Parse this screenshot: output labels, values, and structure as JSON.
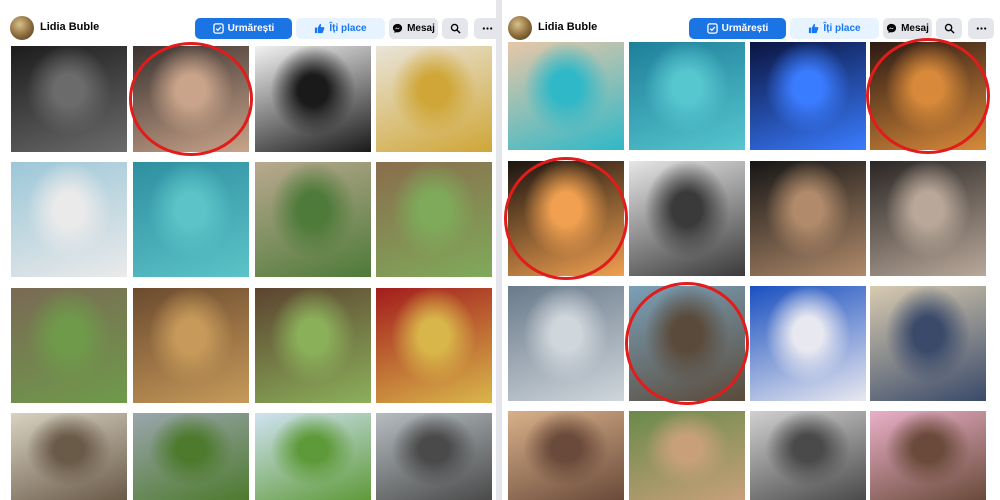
{
  "left": {
    "profile_name": "Lidia Buble",
    "buttons": {
      "follow_label": "Urmărești",
      "like_label": "Îți place",
      "message_label": "Mesaj"
    },
    "icons": {
      "follow": "follow-check-icon",
      "like": "thumbs-up-icon",
      "message": "messenger-icon",
      "search": "search-icon",
      "more": "more-dots-icon"
    },
    "photos": [
      {
        "desc": "black-and-white leather jacket portrait",
        "colors": [
          "#1c1c1c",
          "#6b6b6b"
        ]
      },
      {
        "desc": "couple kissing, woman in black hat",
        "colors": [
          "#3a3230",
          "#c9a48a"
        ],
        "circled": true
      },
      {
        "desc": "black blazer white background",
        "colors": [
          "#f2f2f2",
          "#1a1a1a"
        ]
      },
      {
        "desc": "yellow suit on white sofa",
        "colors": [
          "#e9e4d8",
          "#cfa637"
        ]
      },
      {
        "desc": "white dress by pool",
        "colors": [
          "#9cc7d8",
          "#eaeaea"
        ]
      },
      {
        "desc": "scuba diving underwater",
        "colors": [
          "#2f8fa0",
          "#5cc3c8"
        ]
      },
      {
        "desc": "monastery gate",
        "colors": [
          "#b9a98e",
          "#4e7a3a"
        ]
      },
      {
        "desc": "monastery well",
        "colors": [
          "#8a6d4d",
          "#7faa5a"
        ]
      },
      {
        "desc": "medieval wall courtyard",
        "colors": [
          "#7a6a55",
          "#6f9a4a"
        ]
      },
      {
        "desc": "painted church interior",
        "colors": [
          "#6b4a2e",
          "#c79a5a"
        ]
      },
      {
        "desc": "wooden house porch",
        "colors": [
          "#5c4330",
          "#8bb05a"
        ]
      },
      {
        "desc": "church altar with roses",
        "colors": [
          "#a31c1c",
          "#d9b64a"
        ]
      },
      {
        "desc": "white monastery gate",
        "colors": [
          "#d8d2c2",
          "#6a5a48"
        ]
      },
      {
        "desc": "grass hill cloudy sky",
        "colors": [
          "#9aa6ad",
          "#4e7a2e"
        ]
      },
      {
        "desc": "black hat on meadow",
        "colors": [
          "#cfe3f0",
          "#5f9a3a"
        ]
      },
      {
        "desc": "church dome cloudy",
        "colors": [
          "#b5bcc0",
          "#4a4a4a"
        ]
      }
    ]
  },
  "right": {
    "profile_name": "Lidia Buble",
    "buttons": {
      "follow_label": "Urmărești",
      "like_label": "Îți place",
      "message_label": "Mesaj"
    },
    "icons": {
      "follow": "follow-check-icon",
      "like": "thumbs-up-icon",
      "message": "messenger-icon",
      "search": "search-icon",
      "more": "more-dots-icon"
    },
    "photos": [
      {
        "desc": "sunbathing on pool float",
        "colors": [
          "#e8c7a8",
          "#2fb8c7"
        ]
      },
      {
        "desc": "diving underwater",
        "colors": [
          "#1e7f9a",
          "#56c6cf"
        ]
      },
      {
        "desc": "blue neon portrait",
        "colors": [
          "#0a1440",
          "#3a7cff"
        ]
      },
      {
        "desc": "sunset couple kiss",
        "colors": [
          "#2b1a14",
          "#d88a3a"
        ],
        "circled": true
      },
      {
        "desc": "sunset beach silhouette",
        "colors": [
          "#1a1410",
          "#f0a050"
        ],
        "circled": true
      },
      {
        "desc": "palm trees black and white",
        "colors": [
          "#e6e6e6",
          "#3a3a3a"
        ]
      },
      {
        "desc": "sunglasses dark portrait",
        "colors": [
          "#151515",
          "#b08a6a"
        ]
      },
      {
        "desc": "chanel outfit on sofa",
        "colors": [
          "#2a2624",
          "#b9a89a"
        ]
      },
      {
        "desc": "sitting on stone ledge airport",
        "colors": [
          "#6a7a8a",
          "#cfd6dc"
        ]
      },
      {
        "desc": "selfie couple outdoors",
        "colors": [
          "#7aa0b8",
          "#5a4a3a"
        ],
        "circled": true
      },
      {
        "desc": "tv studio next star",
        "colors": [
          "#1a50c0",
          "#e8e8f0"
        ]
      },
      {
        "desc": "reading newspaper",
        "colors": [
          "#d8cbb0",
          "#3a4a6a"
        ]
      },
      {
        "desc": "selfie car",
        "colors": [
          "#d8b08a",
          "#6a4a3a"
        ]
      },
      {
        "desc": "lying on grass",
        "colors": [
          "#6a8a4a",
          "#c7a07a"
        ]
      },
      {
        "desc": "sunglasses in airplane",
        "colors": [
          "#d0d0d0",
          "#4a4a4a"
        ]
      },
      {
        "desc": "pink light selfie",
        "colors": [
          "#e9b0c8",
          "#6a4a3a"
        ]
      }
    ]
  }
}
